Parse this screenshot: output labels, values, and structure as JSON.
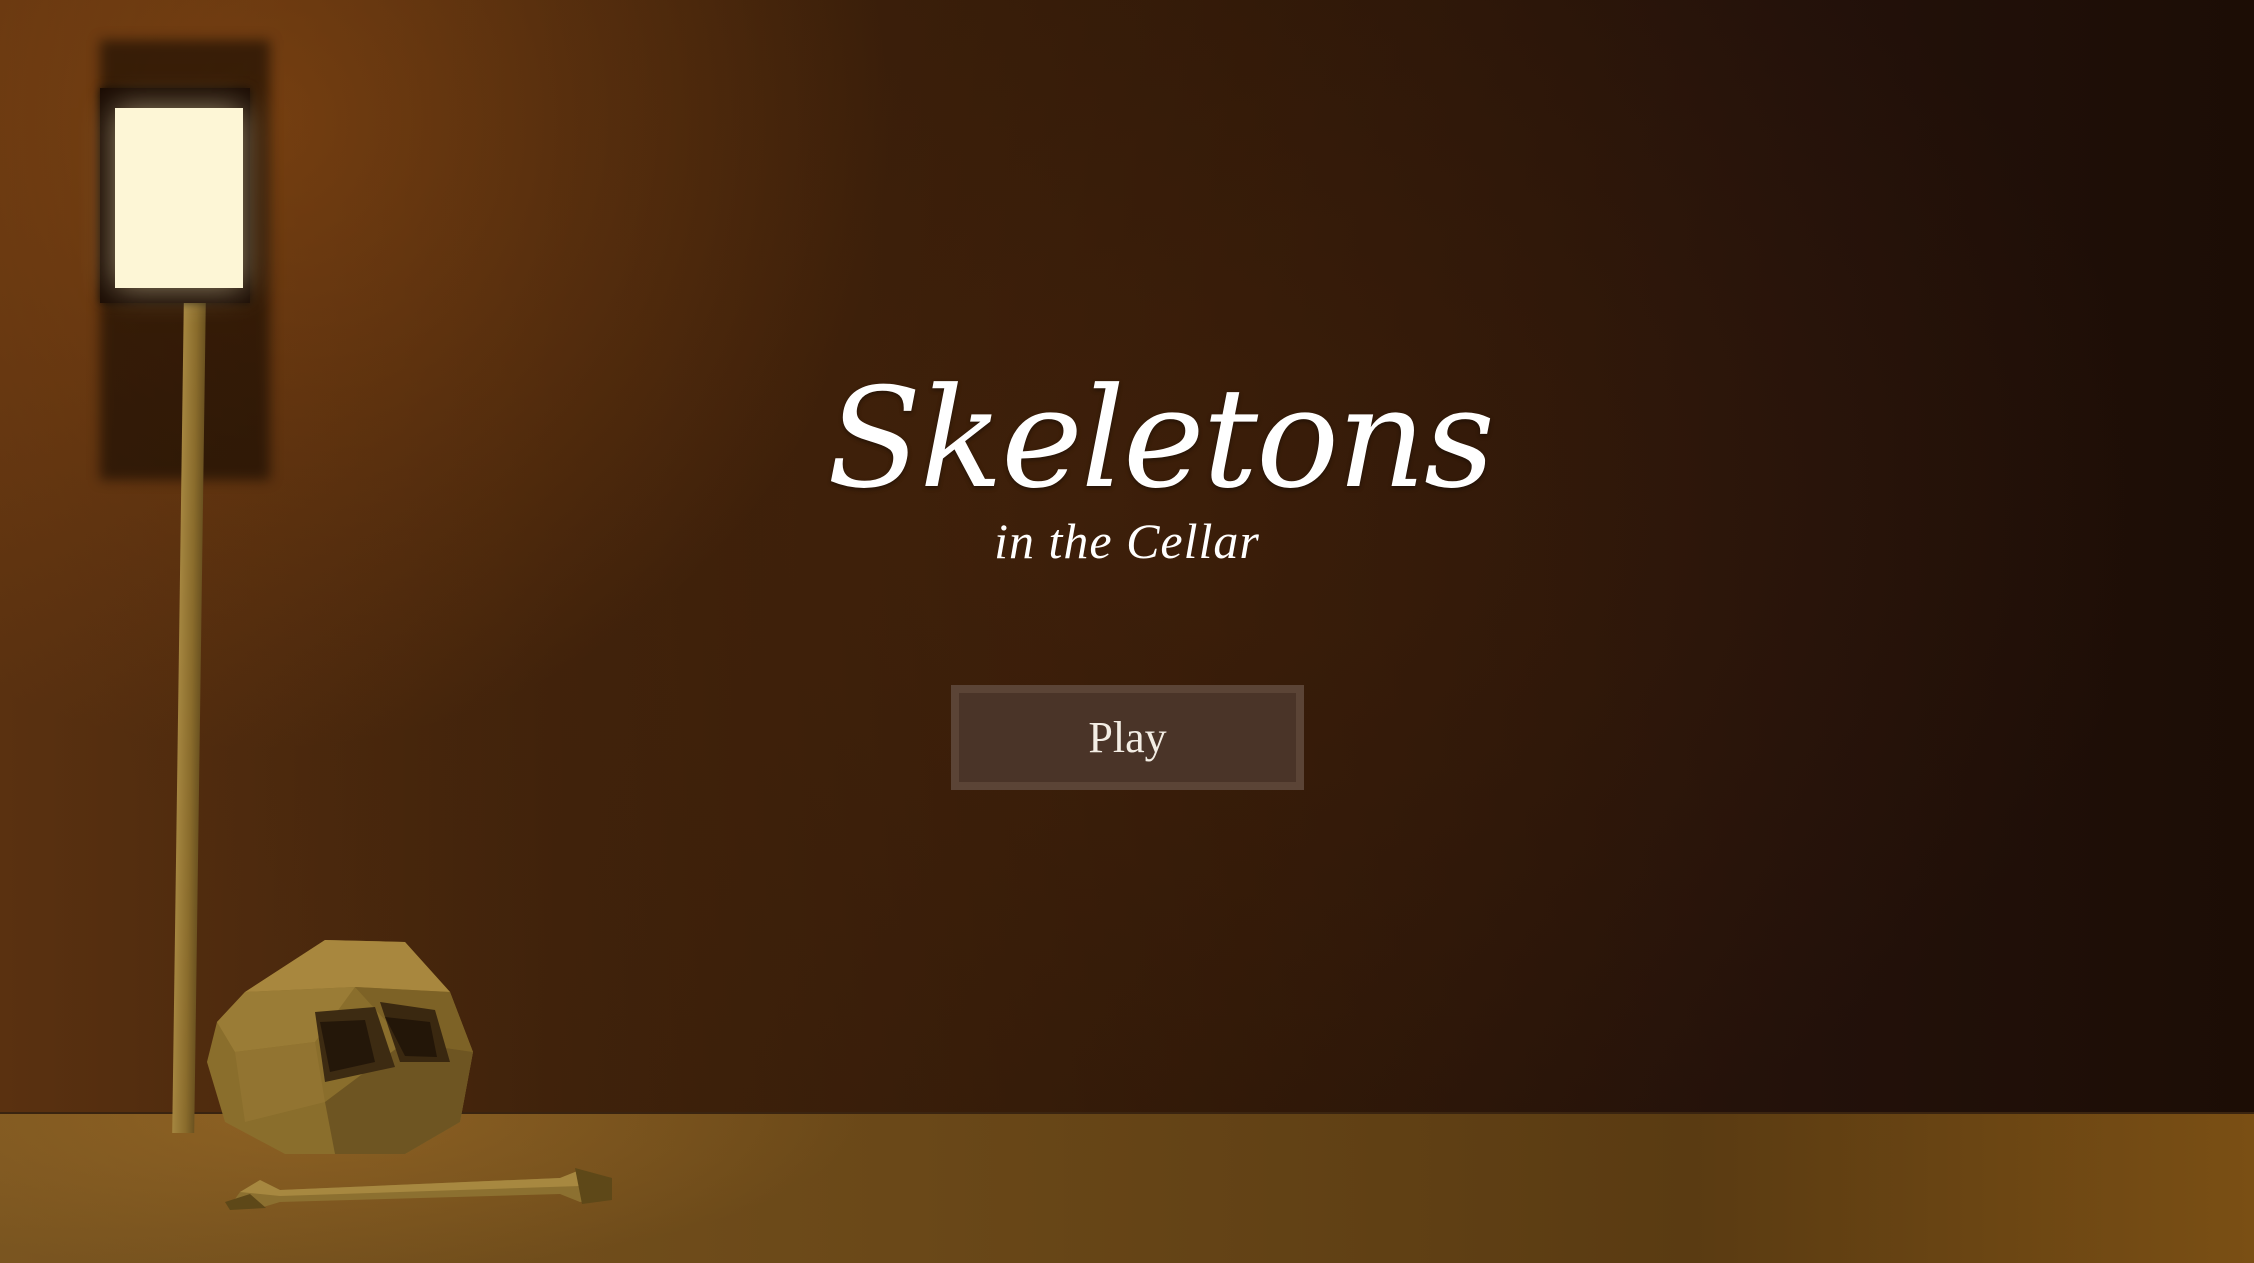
{
  "title": {
    "main": "Skeletons",
    "subtitle": "in the Cellar"
  },
  "menu": {
    "play_label": "Play"
  },
  "scene": {
    "objects": [
      "lamp-icon",
      "skull-icon",
      "bone-icon"
    ]
  },
  "colors": {
    "wall": "#3f220b",
    "floor": "#6a4818",
    "lamp_light": "#fdf6d6",
    "button_bg": "#4a3428",
    "title_text": "#ffffff"
  }
}
